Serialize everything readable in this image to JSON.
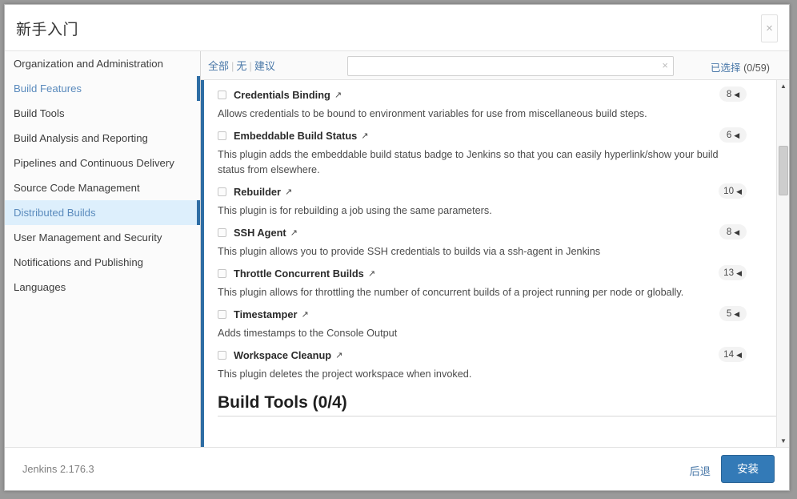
{
  "window": {
    "title": "新手入门",
    "close_label": "×"
  },
  "sidebar": {
    "items": [
      {
        "label": "Organization and Administration",
        "state": "normal"
      },
      {
        "label": "Build Features",
        "state": "link-accent"
      },
      {
        "label": "Build Tools",
        "state": "normal"
      },
      {
        "label": "Build Analysis and Reporting",
        "state": "normal"
      },
      {
        "label": "Pipelines and Continuous Delivery",
        "state": "normal"
      },
      {
        "label": "Source Code Management",
        "state": "normal"
      },
      {
        "label": "Distributed Builds",
        "state": "active"
      },
      {
        "label": "User Management and Security",
        "state": "normal"
      },
      {
        "label": "Notifications and Publishing",
        "state": "normal"
      },
      {
        "label": "Languages",
        "state": "normal"
      }
    ]
  },
  "toolbar": {
    "filter_all": "全部",
    "filter_none": "无",
    "filter_suggested": "建议",
    "separator": "|",
    "search_value": "",
    "search_placeholder": "",
    "search_clear_icon": "×",
    "selected_label": "已选择",
    "selected_value": "(0/59)"
  },
  "plugins": [
    {
      "name": "Credentials Binding",
      "link_icon": "↗",
      "count": "8",
      "triangle": "◀",
      "checked": false,
      "description": "Allows credentials to be bound to environment variables for use from miscellaneous build steps."
    },
    {
      "name": "Embeddable Build Status",
      "link_icon": "↗",
      "count": "6",
      "triangle": "◀",
      "checked": false,
      "description": "This plugin adds the embeddable build status badge to Jenkins so that you can easily hyperlink/show your build status from elsewhere."
    },
    {
      "name": "Rebuilder",
      "link_icon": "↗",
      "count": "10",
      "triangle": "◀",
      "checked": false,
      "description": "This plugin is for rebuilding a job using the same parameters."
    },
    {
      "name": "SSH Agent",
      "link_icon": "↗",
      "count": "8",
      "triangle": "◀",
      "checked": false,
      "description": "This plugin allows you to provide SSH credentials to builds via a ssh-agent in Jenkins"
    },
    {
      "name": "Throttle Concurrent Builds",
      "link_icon": "↗",
      "count": "13",
      "triangle": "◀",
      "checked": false,
      "description": "This plugin allows for throttling the number of concurrent builds of a project running per node or globally."
    },
    {
      "name": "Timestamper",
      "link_icon": "↗",
      "count": "5",
      "triangle": "◀",
      "checked": false,
      "description": "Adds timestamps to the Console Output"
    },
    {
      "name": "Workspace Cleanup",
      "link_icon": "↗",
      "count": "14",
      "triangle": "◀",
      "checked": false,
      "description": "This plugin deletes the project workspace when invoked."
    }
  ],
  "next_section": {
    "heading": "Build Tools (0/4)"
  },
  "scrollbar": {
    "up_arrow": "▲",
    "down_arrow": "▼"
  },
  "footer": {
    "version": "Jenkins 2.176.3",
    "back_label": "后退",
    "install_label": "安装"
  },
  "colors": {
    "accent_blue": "#2e6da4",
    "link_blue": "#4a78a8",
    "active_bg": "#ddeffc",
    "button_blue": "#337ab7"
  }
}
